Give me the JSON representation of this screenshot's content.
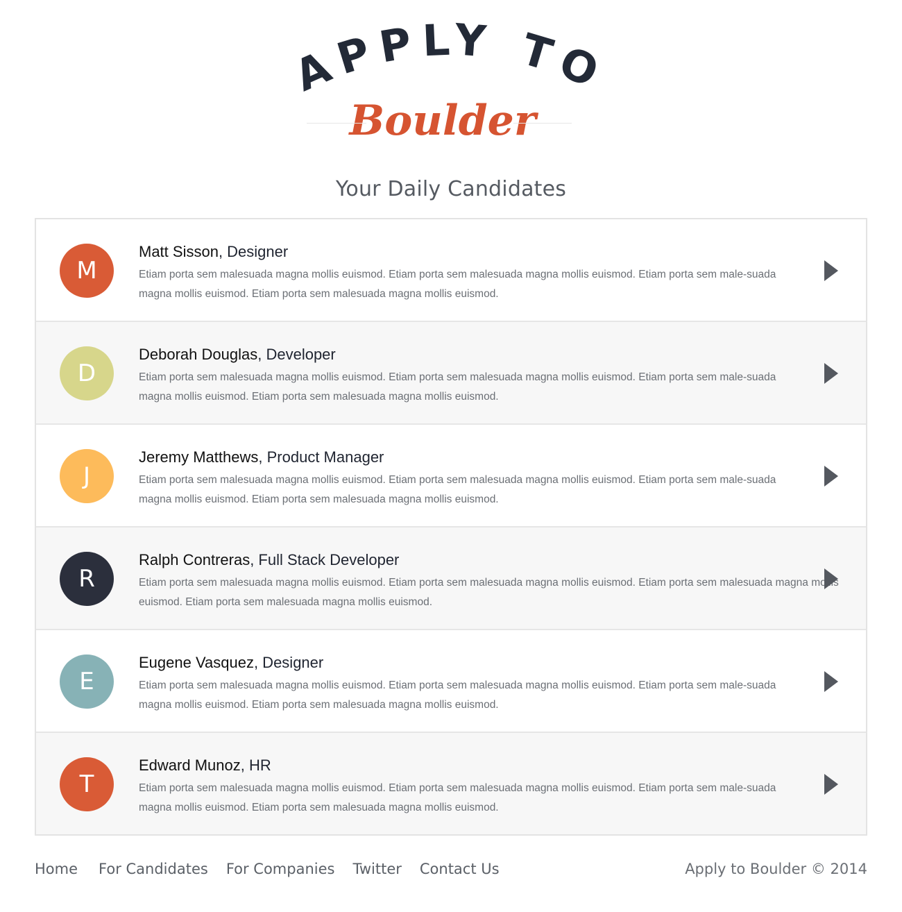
{
  "logo": {
    "line1": "APPLY TO",
    "line2": "Boulder",
    "colors": {
      "dark": "#232a37",
      "accent": "#d65431"
    }
  },
  "page": {
    "title": "Your Daily Candidates"
  },
  "candidates": [
    {
      "initial": "M",
      "name": "Matt Sisson",
      "role": ", Designer",
      "color": "#d95b36",
      "description": "Etiam porta sem malesuada magna mollis euismod. Etiam porta sem malesuada magna mollis euismod. Etiam porta sem male-suada magna mollis euismod. Etiam porta sem malesuada magna mollis euismod."
    },
    {
      "initial": "D",
      "name": "Deborah Douglas",
      "role": ", Developer",
      "color": "#d7d68b",
      "description": "Etiam porta sem malesuada magna mollis euismod. Etiam porta sem malesuada magna mollis euismod. Etiam porta sem male-suada magna mollis euismod. Etiam porta sem malesuada magna mollis euismod."
    },
    {
      "initial": "J",
      "name": "Jeremy Matthews",
      "role": ", Product Manager",
      "color": "#fdbb5b",
      "description": "Etiam porta sem malesuada magna mollis euismod. Etiam porta sem malesuada magna mollis euismod. Etiam porta sem male-suada magna mollis euismod. Etiam porta sem malesuada magna mollis euismod."
    },
    {
      "initial": "R",
      "name": "Ralph Contreras",
      "role": ", Full Stack Developer",
      "color": "#2b2f3c",
      "description": "Etiam porta sem malesuada magna mollis euismod. Etiam porta sem malesuada magna mollis euismod. Etiam porta sem malesuada magna mollis euismod. Etiam porta sem malesuada magna mollis euismod."
    },
    {
      "initial": "E",
      "name": "Eugene Vasquez",
      "role": ", Designer",
      "color": "#87b2b6",
      "description": "Etiam porta sem malesuada magna mollis euismod. Etiam porta sem malesuada magna mollis euismod. Etiam porta sem male-suada magna mollis euismod. Etiam porta sem malesuada magna mollis euismod."
    },
    {
      "initial": "T",
      "name": "Edward Munoz",
      "role": ", HR",
      "color": "#d95b36",
      "description": "Etiam porta sem malesuada magna mollis euismod. Etiam porta sem malesuada magna mollis euismod. Etiam porta sem male-suada magna mollis euismod. Etiam porta sem malesuada magna mollis euismod."
    }
  ],
  "footer": {
    "links": [
      "Home",
      "For Candidates",
      "For Companies",
      "Twitter",
      "Contact Us"
    ],
    "copyright": "Apply to Boulder © 2014"
  },
  "icons": {
    "row_action": "chevron-right-icon"
  }
}
